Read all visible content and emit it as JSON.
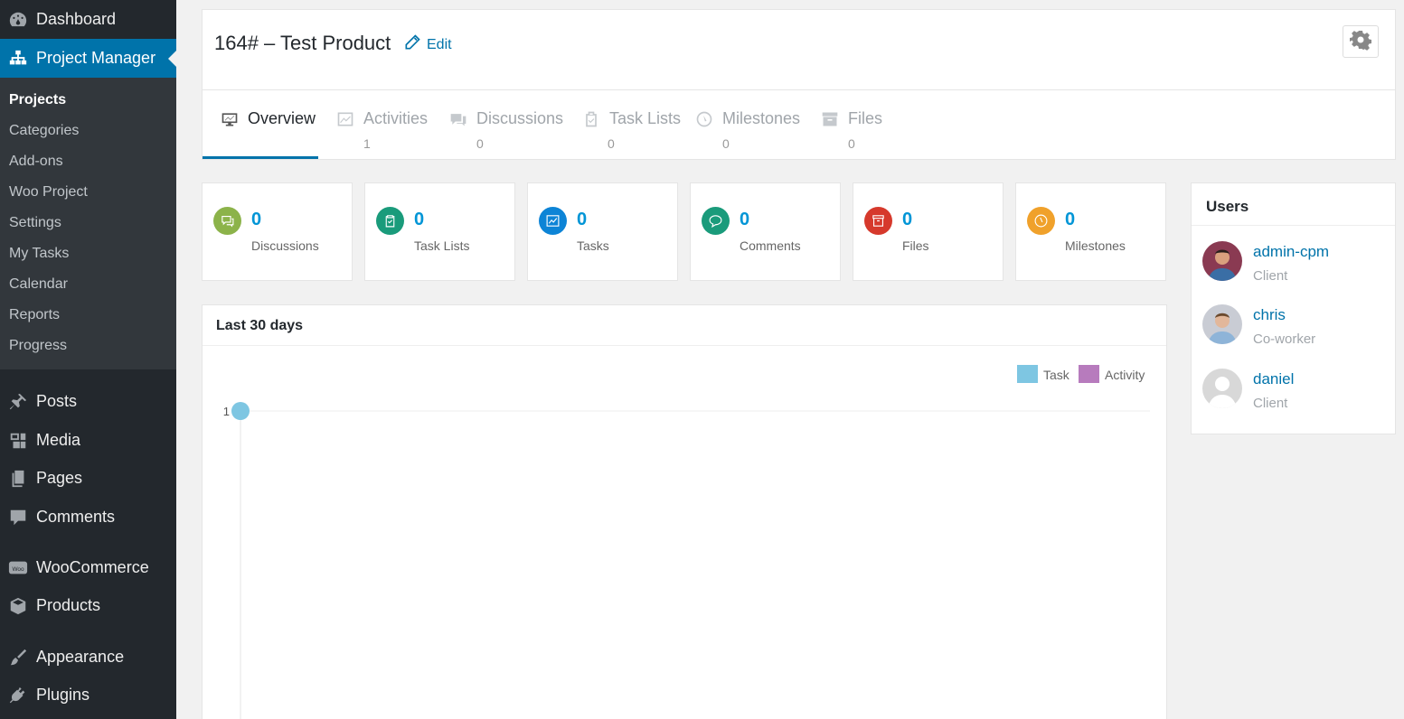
{
  "sidebar": {
    "dashboard": "Dashboard",
    "project_manager": "Project Manager",
    "submenu": [
      "Projects",
      "Categories",
      "Add-ons",
      "Woo Project",
      "Settings",
      "My Tasks",
      "Calendar",
      "Reports",
      "Progress"
    ],
    "posts": "Posts",
    "media": "Media",
    "pages": "Pages",
    "comments": "Comments",
    "woocommerce": "WooCommerce",
    "products": "Products",
    "appearance": "Appearance",
    "plugins": "Plugins"
  },
  "header": {
    "title": "164# – Test Product",
    "edit": "Edit"
  },
  "tabs": [
    {
      "label": "Overview",
      "count": ""
    },
    {
      "label": "Activities",
      "count": "1"
    },
    {
      "label": "Discussions",
      "count": "0"
    },
    {
      "label": "Task Lists",
      "count": "0"
    },
    {
      "label": "Milestones",
      "count": "0"
    },
    {
      "label": "Files",
      "count": "0"
    }
  ],
  "stats": [
    {
      "value": "0",
      "label": "Discussions",
      "color": "#8cb34a"
    },
    {
      "value": "0",
      "label": "Task Lists",
      "color": "#1a9b7b"
    },
    {
      "value": "0",
      "label": "Tasks",
      "color": "#0d84d6"
    },
    {
      "value": "0",
      "label": "Comments",
      "color": "#1a9b7b"
    },
    {
      "value": "0",
      "label": "Files",
      "color": "#d6392c"
    },
    {
      "value": "0",
      "label": "Milestones",
      "color": "#f0a12b"
    }
  ],
  "chart": {
    "title": "Last 30 days"
  },
  "chart_data": {
    "type": "line",
    "y_ticks": [
      "1"
    ],
    "series": [
      {
        "name": "Task",
        "color": "#7ec6e2",
        "points": [
          1
        ]
      },
      {
        "name": "Activity",
        "color": "#b77bbd",
        "points": []
      }
    ],
    "legend_position": "top-right",
    "grid": true
  },
  "users": {
    "title": "Users",
    "list": [
      {
        "name": "admin-cpm",
        "role": "Client"
      },
      {
        "name": "chris",
        "role": "Co-worker"
      },
      {
        "name": "daniel",
        "role": "Client"
      }
    ]
  }
}
